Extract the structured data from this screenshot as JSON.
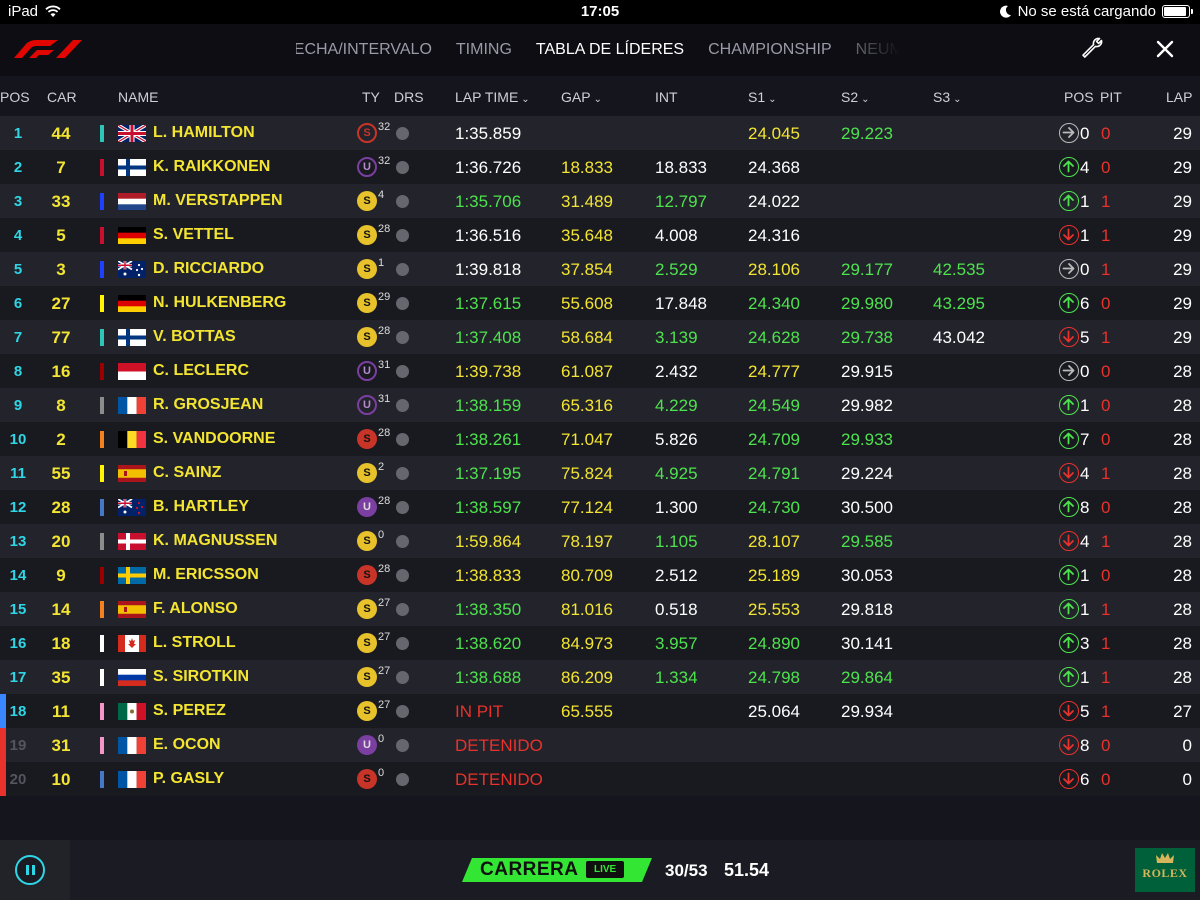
{
  "status_bar": {
    "device": "iPad",
    "time": "17:05",
    "charging": "No se está cargando"
  },
  "nav": {
    "tabs": [
      {
        "label": "FECHA/INTERVALO"
      },
      {
        "label": "TIMING"
      },
      {
        "label": "TABLA DE LÍDERES",
        "active": true
      },
      {
        "label": "CHAMPIONSHIP"
      },
      {
        "label": "NEUMÁTICOS"
      }
    ],
    "icons": [
      "f1-logo-icon",
      "wrench-icon",
      "close-icon"
    ]
  },
  "columns": {
    "pos": "POS",
    "car": "CAR",
    "name": "NAME",
    "ty": "TY",
    "drs": "DRS",
    "lap_time": "LAP TIME",
    "gap": "GAP",
    "int": "INT",
    "s1": "S1",
    "s2": "S2",
    "s3": "S3",
    "pos_change": "POS",
    "pit": "PIT",
    "lap": "LAP"
  },
  "colors": {
    "position": "#2fd6e5",
    "driver": "#f3e531",
    "personal_best": "#4de34d",
    "alert": "#e8322b",
    "soft_tyre": "#e8c22b",
    "race_badge": "#33e633"
  },
  "standings": [
    {
      "pos": "1",
      "car": "44",
      "team": "#2ec4b6",
      "flag": "gb",
      "name": "L. HAMILTON",
      "tyre": "S",
      "tyre_style": "ring-red",
      "tyre_age": "32",
      "lap_time": "1:35.859",
      "lt_c": "w",
      "gap": "",
      "gap_c": "y",
      "int": "",
      "int_c": "w",
      "s1": "24.045",
      "s1_c": "y",
      "s2": "29.223",
      "s2_c": "g",
      "s3": "",
      "s3_c": "w",
      "dir": "same",
      "pos_change": "0",
      "pit": "0",
      "lap": "29"
    },
    {
      "pos": "2",
      "car": "7",
      "team": "#c8102e",
      "flag": "fi",
      "name": "K. RAIKKONEN",
      "tyre": "U",
      "tyre_style": "ring-purple",
      "tyre_age": "32",
      "lap_time": "1:36.726",
      "lt_c": "w",
      "gap": "18.833",
      "gap_c": "y",
      "int": "18.833",
      "int_c": "w",
      "s1": "24.368",
      "s1_c": "w",
      "s2": "",
      "s2_c": "w",
      "s3": "",
      "s3_c": "w",
      "dir": "up",
      "pos_change": "4",
      "pit": "0",
      "lap": "29"
    },
    {
      "pos": "3",
      "car": "33",
      "team": "#1e41ff",
      "flag": "nl",
      "name": "M. VERSTAPPEN",
      "tyre": "S",
      "tyre_style": "soft",
      "tyre_age": "4",
      "lap_time": "1:35.706",
      "lt_c": "g",
      "gap": "31.489",
      "gap_c": "y",
      "int": "12.797",
      "int_c": "g",
      "s1": "24.022",
      "s1_c": "w",
      "s2": "",
      "s2_c": "w",
      "s3": "",
      "s3_c": "w",
      "dir": "up",
      "pos_change": "1",
      "pit": "1",
      "lap": "29"
    },
    {
      "pos": "4",
      "car": "5",
      "team": "#c8102e",
      "flag": "de",
      "name": "S. VETTEL",
      "tyre": "S",
      "tyre_style": "soft",
      "tyre_age": "28",
      "lap_time": "1:36.516",
      "lt_c": "w",
      "gap": "35.648",
      "gap_c": "y",
      "int": "4.008",
      "int_c": "w",
      "s1": "24.316",
      "s1_c": "w",
      "s2": "",
      "s2_c": "w",
      "s3": "",
      "s3_c": "w",
      "dir": "down",
      "pos_change": "1",
      "pit": "1",
      "lap": "29"
    },
    {
      "pos": "5",
      "car": "3",
      "team": "#1e41ff",
      "flag": "au",
      "name": "D. RICCIARDO",
      "tyre": "S",
      "tyre_style": "soft",
      "tyre_age": "1",
      "lap_time": "1:39.818",
      "lt_c": "w",
      "gap": "37.854",
      "gap_c": "y",
      "int": "2.529",
      "int_c": "g",
      "s1": "28.106",
      "s1_c": "y",
      "s2": "29.177",
      "s2_c": "g",
      "s3": "42.535",
      "s3_c": "g",
      "dir": "same",
      "pos_change": "0",
      "pit": "1",
      "lap": "29"
    },
    {
      "pos": "6",
      "car": "27",
      "team": "#fff500",
      "flag": "de",
      "name": "N. HULKENBERG",
      "tyre": "S",
      "tyre_style": "soft",
      "tyre_age": "29",
      "lap_time": "1:37.615",
      "lt_c": "g",
      "gap": "55.608",
      "gap_c": "y",
      "int": "17.848",
      "int_c": "w",
      "s1": "24.340",
      "s1_c": "g",
      "s2": "29.980",
      "s2_c": "g",
      "s3": "43.295",
      "s3_c": "g",
      "dir": "up",
      "pos_change": "6",
      "pit": "0",
      "lap": "29"
    },
    {
      "pos": "7",
      "car": "77",
      "team": "#2ec4b6",
      "flag": "fi",
      "name": "V. BOTTAS",
      "tyre": "S",
      "tyre_style": "soft",
      "tyre_age": "28",
      "lap_time": "1:37.408",
      "lt_c": "g",
      "gap": "58.684",
      "gap_c": "y",
      "int": "3.139",
      "int_c": "g",
      "s1": "24.628",
      "s1_c": "g",
      "s2": "29.738",
      "s2_c": "g",
      "s3": "43.042",
      "s3_c": "w",
      "dir": "down",
      "pos_change": "5",
      "pit": "1",
      "lap": "29"
    },
    {
      "pos": "8",
      "car": "16",
      "team": "#9b0000",
      "flag": "mc",
      "name": "C. LECLERC",
      "tyre": "U",
      "tyre_style": "ring-purple",
      "tyre_age": "31",
      "lap_time": "1:39.738",
      "lt_c": "y",
      "gap": "61.087",
      "gap_c": "y",
      "int": "2.432",
      "int_c": "w",
      "s1": "24.777",
      "s1_c": "y",
      "s2": "29.915",
      "s2_c": "w",
      "s3": "",
      "s3_c": "w",
      "dir": "same",
      "pos_change": "0",
      "pit": "0",
      "lap": "28"
    },
    {
      "pos": "9",
      "car": "8",
      "team": "#8c8c8c",
      "flag": "fr",
      "name": "R. GROSJEAN",
      "tyre": "U",
      "tyre_style": "ring-purple",
      "tyre_age": "31",
      "lap_time": "1:38.159",
      "lt_c": "g",
      "gap": "65.316",
      "gap_c": "y",
      "int": "4.229",
      "int_c": "g",
      "s1": "24.549",
      "s1_c": "g",
      "s2": "29.982",
      "s2_c": "w",
      "s3": "",
      "s3_c": "w",
      "dir": "up",
      "pos_change": "1",
      "pit": "0",
      "lap": "28"
    },
    {
      "pos": "10",
      "car": "2",
      "team": "#f58020",
      "flag": "be",
      "name": "S. VANDOORNE",
      "tyre": "S",
      "tyre_style": "red",
      "tyre_age": "28",
      "lap_time": "1:38.261",
      "lt_c": "g",
      "gap": "71.047",
      "gap_c": "y",
      "int": "5.826",
      "int_c": "w",
      "s1": "24.709",
      "s1_c": "g",
      "s2": "29.933",
      "s2_c": "g",
      "s3": "",
      "s3_c": "w",
      "dir": "up",
      "pos_change": "7",
      "pit": "0",
      "lap": "28"
    },
    {
      "pos": "11",
      "car": "55",
      "team": "#fff500",
      "flag": "es",
      "name": "C. SAINZ",
      "tyre": "S",
      "tyre_style": "soft",
      "tyre_age": "2",
      "lap_time": "1:37.195",
      "lt_c": "g",
      "gap": "75.824",
      "gap_c": "y",
      "int": "4.925",
      "int_c": "g",
      "s1": "24.791",
      "s1_c": "g",
      "s2": "29.224",
      "s2_c": "w",
      "s3": "",
      "s3_c": "w",
      "dir": "down",
      "pos_change": "4",
      "pit": "1",
      "lap": "28"
    },
    {
      "pos": "12",
      "car": "28",
      "team": "#4678c8",
      "flag": "nz",
      "name": "B. HARTLEY",
      "tyre": "U",
      "tyre_style": "us",
      "tyre_age": "28",
      "lap_time": "1:38.597",
      "lt_c": "g",
      "gap": "77.124",
      "gap_c": "y",
      "int": "1.300",
      "int_c": "w",
      "s1": "24.730",
      "s1_c": "g",
      "s2": "30.500",
      "s2_c": "w",
      "s3": "",
      "s3_c": "w",
      "dir": "up",
      "pos_change": "8",
      "pit": "0",
      "lap": "28"
    },
    {
      "pos": "13",
      "car": "20",
      "team": "#8c8c8c",
      "flag": "dk",
      "name": "K. MAGNUSSEN",
      "tyre": "S",
      "tyre_style": "soft",
      "tyre_age": "0",
      "lap_time": "1:59.864",
      "lt_c": "y",
      "gap": "78.197",
      "gap_c": "y",
      "int": "1.105",
      "int_c": "g",
      "s1": "28.107",
      "s1_c": "y",
      "s2": "29.585",
      "s2_c": "g",
      "s3": "",
      "s3_c": "w",
      "dir": "down",
      "pos_change": "4",
      "pit": "1",
      "lap": "28"
    },
    {
      "pos": "14",
      "car": "9",
      "team": "#9b0000",
      "flag": "se",
      "name": "M. ERICSSON",
      "tyre": "S",
      "tyre_style": "red",
      "tyre_age": "28",
      "lap_time": "1:38.833",
      "lt_c": "y",
      "gap": "80.709",
      "gap_c": "y",
      "int": "2.512",
      "int_c": "w",
      "s1": "25.189",
      "s1_c": "y",
      "s2": "30.053",
      "s2_c": "w",
      "s3": "",
      "s3_c": "w",
      "dir": "up",
      "pos_change": "1",
      "pit": "0",
      "lap": "28"
    },
    {
      "pos": "15",
      "car": "14",
      "team": "#f58020",
      "flag": "es",
      "name": "F. ALONSO",
      "tyre": "S",
      "tyre_style": "soft",
      "tyre_age": "27",
      "lap_time": "1:38.350",
      "lt_c": "g",
      "gap": "81.016",
      "gap_c": "y",
      "int": "0.518",
      "int_c": "w",
      "s1": "25.553",
      "s1_c": "y",
      "s2": "29.818",
      "s2_c": "w",
      "s3": "",
      "s3_c": "w",
      "dir": "up",
      "pos_change": "1",
      "pit": "1",
      "lap": "28"
    },
    {
      "pos": "16",
      "car": "18",
      "team": "#ffffff",
      "flag": "ca",
      "name": "L. STROLL",
      "tyre": "S",
      "tyre_style": "soft",
      "tyre_age": "27",
      "lap_time": "1:38.620",
      "lt_c": "g",
      "gap": "84.973",
      "gap_c": "y",
      "int": "3.957",
      "int_c": "g",
      "s1": "24.890",
      "s1_c": "g",
      "s2": "30.141",
      "s2_c": "w",
      "s3": "",
      "s3_c": "w",
      "dir": "up",
      "pos_change": "3",
      "pit": "1",
      "lap": "28"
    },
    {
      "pos": "17",
      "car": "35",
      "team": "#ffffff",
      "flag": "ru",
      "name": "S. SIROTKIN",
      "tyre": "S",
      "tyre_style": "soft",
      "tyre_age": "27",
      "lap_time": "1:38.688",
      "lt_c": "g",
      "gap": "86.209",
      "gap_c": "y",
      "int": "1.334",
      "int_c": "g",
      "s1": "24.798",
      "s1_c": "g",
      "s2": "29.864",
      "s2_c": "g",
      "s3": "",
      "s3_c": "w",
      "dir": "up",
      "pos_change": "1",
      "pit": "1",
      "lap": "28"
    },
    {
      "pos": "18",
      "car": "11",
      "team": "#f596c8",
      "flag": "mx",
      "name": "S. PEREZ",
      "tyre": "S",
      "tyre_style": "soft",
      "tyre_age": "27",
      "lap_time": "IN PIT",
      "lt_c": "r",
      "gap": "65.555",
      "gap_c": "y",
      "int": "",
      "int_c": "w",
      "s1": "25.064",
      "s1_c": "w",
      "s2": "29.934",
      "s2_c": "w",
      "s3": "",
      "s3_c": "w",
      "dir": "down",
      "pos_change": "5",
      "pit": "1",
      "lap": "27",
      "marker": "#3a86ff"
    },
    {
      "pos": "19",
      "car": "31",
      "team": "#f596c8",
      "flag": "fr",
      "name": "E. OCON",
      "tyre": "U",
      "tyre_style": "us",
      "tyre_age": "0",
      "lap_time": "DETENIDO",
      "lt_c": "r",
      "gap": "",
      "gap_c": "y",
      "int": "",
      "int_c": "w",
      "s1": "",
      "s1_c": "w",
      "s2": "",
      "s2_c": "w",
      "s3": "",
      "s3_c": "w",
      "dir": "down",
      "pos_change": "8",
      "pit": "0",
      "lap": "0",
      "out": true,
      "marker": "#e8322b"
    },
    {
      "pos": "20",
      "car": "10",
      "team": "#4678c8",
      "flag": "fr",
      "name": "P. GASLY",
      "tyre": "S",
      "tyre_style": "red",
      "tyre_age": "0",
      "lap_time": "DETENIDO",
      "lt_c": "r",
      "gap": "",
      "gap_c": "y",
      "int": "",
      "int_c": "w",
      "s1": "",
      "s1_c": "w",
      "s2": "",
      "s2_c": "w",
      "s3": "",
      "s3_c": "w",
      "dir": "down",
      "pos_change": "6",
      "pit": "0",
      "lap": "0",
      "out": true,
      "marker": "#e8322b"
    }
  ],
  "bottom": {
    "session": "CARRERA",
    "live": "LIVE",
    "laps": "30/53",
    "time": "51.54",
    "sponsor": "ROLEX",
    "icons": [
      "pause-icon",
      "rolex-crown-icon"
    ]
  }
}
